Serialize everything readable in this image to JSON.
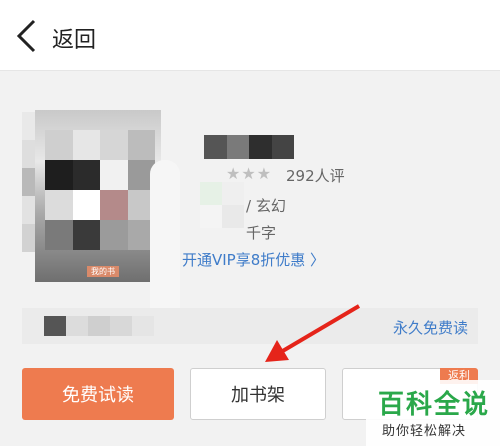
{
  "header": {
    "back_label": "返回"
  },
  "book": {
    "rating_stars": "★★★",
    "rating_count": "292人评",
    "genre": "/ 玄幻",
    "wordcount": "千字",
    "vip_link": "开通VIP享8折优惠 〉",
    "free_forever": "永久免费读",
    "cover_badge": "我的书"
  },
  "actions": {
    "free_trial": "免费试读",
    "add_shelf": "加书架",
    "rebate_tag": "返利"
  },
  "watermark": {
    "title": "百科全说",
    "subtitle": "助你轻松解决"
  },
  "colors": {
    "accent": "#ee7b4f",
    "link": "#3f7cc9",
    "watermark_green": "#2aa84a"
  }
}
